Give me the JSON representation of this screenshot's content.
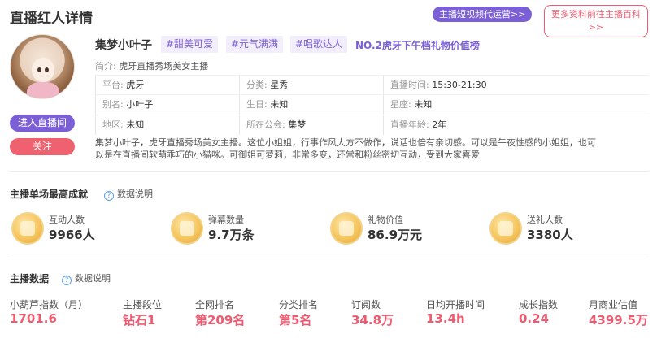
{
  "header": {
    "title": "直播红人详情",
    "video_button": "主播短视频代运营>>",
    "wiki_button_line1": "更多资料前往主播百科",
    "wiki_button_line2": ">>"
  },
  "profile": {
    "name": "集梦小叶子",
    "tags": [
      "#甜美可爱",
      "#元气满满",
      "#唱歌达人"
    ],
    "rank_text": "NO.2虎牙下午档礼物价值榜",
    "brief_label": "简介:",
    "brief": "虎牙直播秀场美女主播",
    "enter_button": "进入直播间",
    "follow_button": "关注",
    "info_rows": [
      [
        {
          "label": "平台:",
          "value": "虎牙"
        },
        {
          "label": "分类:",
          "value": "星秀"
        },
        {
          "label": "直播时间:",
          "value": "15:30-21:30"
        }
      ],
      [
        {
          "label": "别名:",
          "value": "小叶子"
        },
        {
          "label": "生日:",
          "value": "未知"
        },
        {
          "label": "星座:",
          "value": "未知"
        }
      ],
      [
        {
          "label": "地区:",
          "value": "未知"
        },
        {
          "label": "所在公会:",
          "value": "集梦"
        },
        {
          "label": "直播年龄:",
          "value": "2年"
        }
      ]
    ],
    "description_line1": "集梦小叶子，虎牙直播秀场美女主播。这位小姐姐，行事作风大方不做作，说话也倍有亲切感。可以是午夜性感的小姐姐，也可",
    "description_line2": "以是在直播间软萌乖巧的小猫咪。可御姐可萝莉，非常多变，还常和粉丝密切互动，受到大家喜爱"
  },
  "best_record": {
    "title": "主播单场最高成就",
    "help": "数据说明",
    "stats": [
      {
        "label": "互动人数",
        "value": "9966人",
        "icon": "interaction-medal-icon"
      },
      {
        "label": "弹幕数量",
        "value": "9.7万条",
        "icon": "danmaku-medal-icon"
      },
      {
        "label": "礼物价值",
        "value": "86.9万元",
        "icon": "gift-medal-icon"
      },
      {
        "label": "送礼人数",
        "value": "3380人",
        "icon": "gifters-medal-icon"
      }
    ]
  },
  "anchor_data": {
    "title": "主播数据",
    "help": "数据说明",
    "metrics": [
      {
        "label": "小葫芦指数（月）",
        "value": "1701.6"
      },
      {
        "label": "主播段位",
        "value": "钻石1"
      },
      {
        "label": "全网排名",
        "value": "第209名"
      },
      {
        "label": "分类排名",
        "value": "第5名"
      },
      {
        "label": "订阅数",
        "value": "34.8万"
      },
      {
        "label": "日均开播时间",
        "value": "13.4h"
      },
      {
        "label": "成长指数",
        "value": "0.24"
      },
      {
        "label": "月商业估值",
        "value": "4399.5万"
      }
    ]
  },
  "colors": {
    "accent_purple": "#7b5fd6",
    "accent_red": "#ee5a6f",
    "medal_gold": "#f6c65f"
  }
}
